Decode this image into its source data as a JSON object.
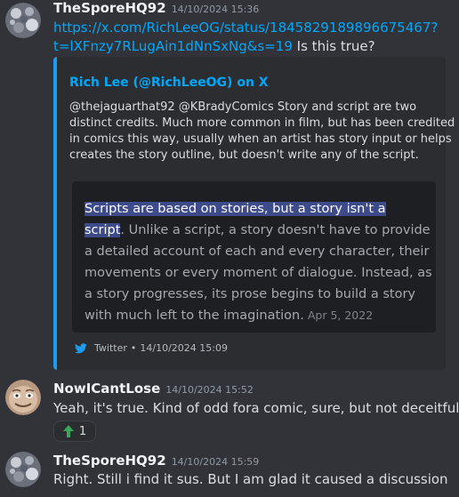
{
  "messages": [
    {
      "username": "TheSporeHQ92",
      "timestamp": "14/10/2024 15:36",
      "link_line1": "https://x.com/RichLeeOG/status/1845829189896675467?",
      "link_line2": "t=lXFnzy7RLugAin1dNnSxNg&s=19",
      "text_after_link": " Is this true?",
      "embed": {
        "author": "Rich Lee (@RichLeeOG) on X",
        "desc_lines": [
          "@thejaguarthat92 @KBradyComics Story and script are two",
          "distinct credits. Much more common in film, but has been credited",
          "in comics this way, usually when an artist has story input or helps",
          "creates the story outline, but doesn't write any of the script."
        ],
        "quote": {
          "highlight_line1": "Scripts are based on stories, but a story isn't a",
          "highlight_line2": "script",
          "line2_rest": ". Unlike a script, a story doesn't have to provide",
          "lines": [
            "a detailed account of each and every character, their",
            "movements or every moment of dialogue. Instead, as",
            "a story progresses, its prose begins to build a story"
          ],
          "last_line": "with much left to the imagination.",
          "date": "Apr 5, 2022"
        },
        "footer_source": "Twitter",
        "footer_sep": "•",
        "footer_timestamp": "14/10/2024 15:09"
      }
    },
    {
      "username": "NowICantLose",
      "timestamp": "14/10/2024 15:52",
      "text": "Yeah, it's true. Kind of odd fora  comic, sure, but not deceitful",
      "reaction": {
        "emoji": "up-arrow-icon",
        "count": "1"
      }
    },
    {
      "username": "TheSporeHQ92",
      "timestamp": "14/10/2024 15:59",
      "text": "Right. Still i find it sus. But I am glad it caused a discussion"
    }
  ],
  "colors": {
    "background": "#313338",
    "embed_bg": "#2b2d31",
    "embed_accent": "#1d9bf0",
    "link": "#00a8fc",
    "highlight": "#3e4b8a"
  }
}
